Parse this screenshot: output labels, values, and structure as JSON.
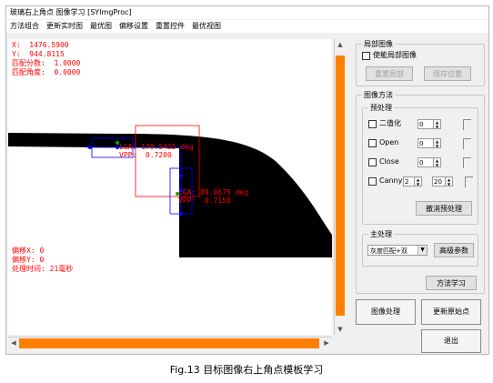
{
  "window": {
    "title": "玻璃右上角点   图像学习 [SYImgProc]"
  },
  "menu": [
    "方法组合",
    "更新实时图",
    "最优图",
    "偏移设置",
    "重置控件",
    "最优视图"
  ],
  "overlay": {
    "x": "X:  1476.5900",
    "y": "Y:  944.8115",
    "score": "匹配分数:  1.0000",
    "angle": "匹配角度:  0.0000",
    "offset_x": "偏移X: 0",
    "offset_y": "偏移Y: 0",
    "time": "处理时间: 21毫秒",
    "lga1": "LGA: 179.5425 deg",
    "vpp1": "VPP:  0.7200",
    "lga2": "LGA: 89.0675 deg",
    "vpp2": "VPP:  0.7150"
  },
  "local_image": {
    "title": "局部图像",
    "enable_label": "使能局部图像",
    "reset_label": "重置局部",
    "save_label": "保存位置"
  },
  "image_method": {
    "title": "图像方法",
    "pre_title": "预处理",
    "binarize_label": "二值化",
    "binarize_value": "0",
    "open_label": "Open",
    "open_value": "0",
    "close_label": "Close",
    "close_value": "0",
    "canny_label": "Canny",
    "canny_value1": "2",
    "canny_value2": "20",
    "undo_pre_label": "撤消预处理",
    "main_title": "主处理",
    "main_select": "灰度匹配+双",
    "advanced_label": "高级参数",
    "learn_label": "方法学习"
  },
  "actions": {
    "process_label": "图像处理",
    "update_origin_label": "更新原始点",
    "exit_label": "退出"
  },
  "caption": "Fig.13 目标图像右上角点模板学习",
  "colors": {
    "accent": "#ff8000",
    "annotation": "#ff0000",
    "template": "#0000ff"
  }
}
